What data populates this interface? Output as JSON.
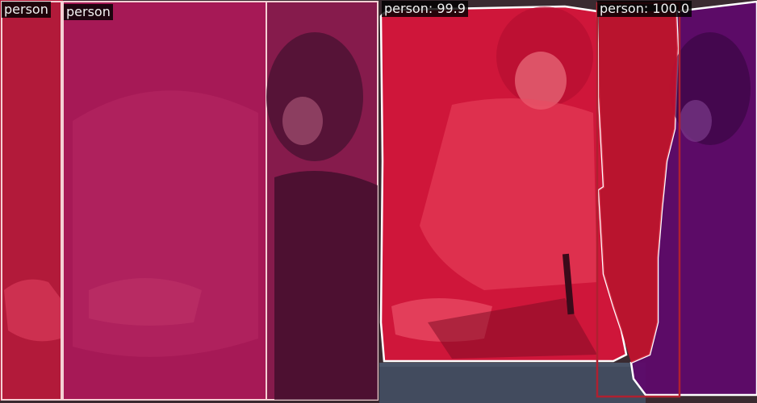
{
  "detections": [
    {
      "label": "person",
      "mask_color": "#c8183c",
      "outline_color": "#f4d0d4"
    },
    {
      "label": "person",
      "mask_color": "#b0185a",
      "outline_color": "#f4d0d4"
    },
    {
      "label": "person: 99.9",
      "mask_color": "#e0143c",
      "outline_color": "#ffffff"
    },
    {
      "label": "person: 100.0",
      "mask_color": "#5e0a6a",
      "outline_color": "#ffffff",
      "box_color": "#b02030"
    }
  ]
}
